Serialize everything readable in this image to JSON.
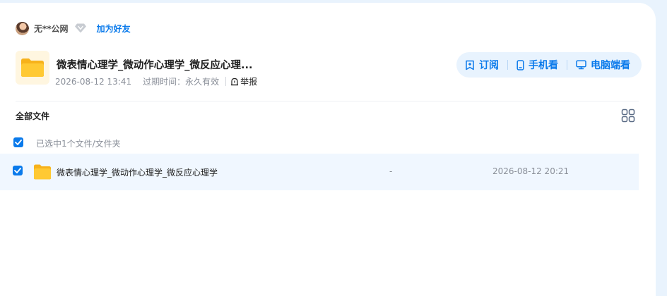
{
  "colors": {
    "accent": "#0a7aeb",
    "page_bg": "#e9f3fd",
    "selected_row_bg": "#f0f7ff",
    "folder_yellow": "#ffc933"
  },
  "owner": {
    "name": "无**公网",
    "vip_icon": "diamond-icon",
    "add_friend": "加为好友"
  },
  "share": {
    "title": "微表情心理学_微动作心理学_微反应心理...",
    "created": "2026-08-12 13:41",
    "expire": "过期时间：永久有效",
    "report": "举报",
    "folder_icon": "folder-icon"
  },
  "actions": {
    "subscribe": "订阅",
    "mobile": "手机看",
    "desktop": "电脑端看"
  },
  "file_list": {
    "header": "全部文件",
    "view_toggle_icon": "grid-view-icon",
    "selection_status": "已选中1个文件/文件夹",
    "select_all_checked": true,
    "rows": [
      {
        "name": "微表情心理学_微动作心理学_微反应心理学",
        "size": "-",
        "date": "2026-08-12 20:21",
        "checked": true
      }
    ]
  }
}
